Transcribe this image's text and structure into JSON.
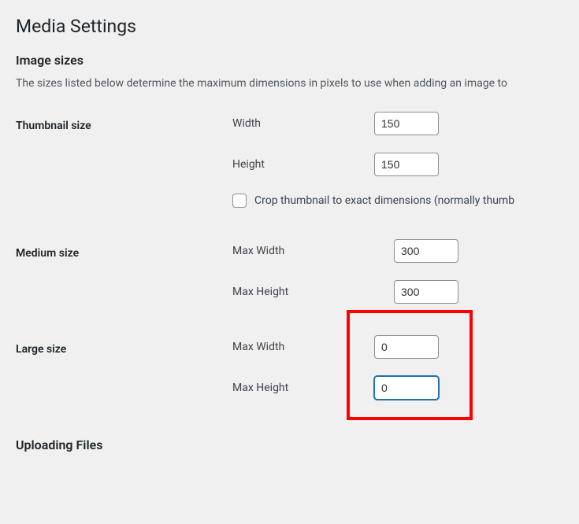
{
  "page": {
    "title": "Media Settings"
  },
  "imageSizes": {
    "heading": "Image sizes",
    "description": "The sizes listed below determine the maximum dimensions in pixels to use when adding an image to"
  },
  "thumbnail": {
    "rowLabel": "Thumbnail size",
    "widthLabel": "Width",
    "widthValue": "150",
    "heightLabel": "Height",
    "heightValue": "150",
    "cropLabel": "Crop thumbnail to exact dimensions (normally thumb"
  },
  "medium": {
    "rowLabel": "Medium size",
    "maxWidthLabel": "Max Width",
    "maxWidthValue": "300",
    "maxHeightLabel": "Max Height",
    "maxHeightValue": "300"
  },
  "large": {
    "rowLabel": "Large size",
    "maxWidthLabel": "Max Width",
    "maxWidthValue": "0",
    "maxHeightLabel": "Max Height",
    "maxHeightValue": "0"
  },
  "uploading": {
    "heading": "Uploading Files"
  }
}
